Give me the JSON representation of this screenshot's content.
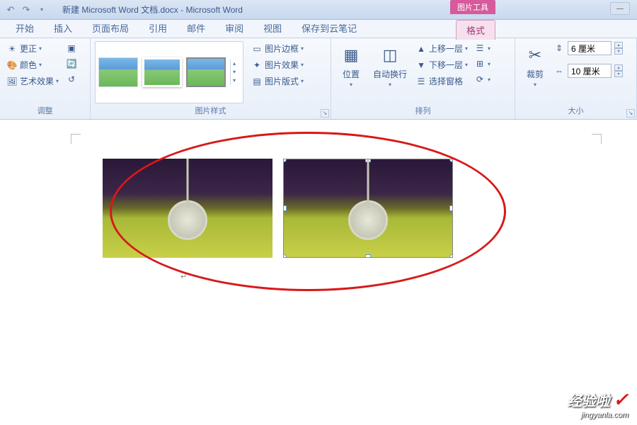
{
  "title_bar": {
    "document_title": "新建 Microsoft Word 文档.docx - Microsoft Word",
    "picture_tools_label": "图片工具"
  },
  "tabs": {
    "start": "开始",
    "insert": "插入",
    "page_layout": "页面布局",
    "references": "引用",
    "mailings": "邮件",
    "review": "审阅",
    "view": "视图",
    "save_cloud": "保存到云笔记",
    "format": "格式"
  },
  "ribbon": {
    "adjust": {
      "corrections": "更正",
      "color": "颜色",
      "artistic": "艺术效果",
      "group_label": "调整"
    },
    "picture_styles": {
      "border": "图片边框",
      "effects": "图片效果",
      "layout": "图片版式",
      "group_label": "图片样式"
    },
    "arrange": {
      "position": "位置",
      "wrap_text": "自动换行",
      "bring_forward": "上移一层",
      "send_backward": "下移一层",
      "selection_pane": "选择窗格",
      "group_label": "排列"
    },
    "size": {
      "crop": "裁剪",
      "height_value": "6 厘米",
      "width_value": "10 厘米",
      "group_label": "大小"
    }
  },
  "watermark": {
    "main": "经验啦",
    "sub": "jingyanla.com"
  }
}
